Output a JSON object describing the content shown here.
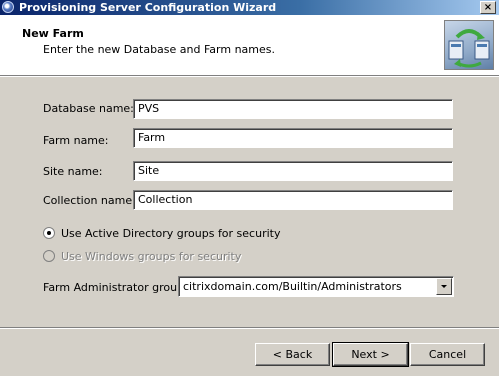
{
  "window": {
    "title": "Provisioning Server Configuration Wizard",
    "close_glyph": "×",
    "icon": "citrix-globe-icon"
  },
  "header": {
    "title": "New Farm",
    "subtitle": "Enter the new Database and Farm names.",
    "logo_icon": "server-sync-icon"
  },
  "form": {
    "database_label": "Database name:",
    "database_value": "PVS",
    "farm_label": "Farm name:",
    "farm_value": "Farm",
    "site_label": "Site name:",
    "site_value": "Site",
    "collection_label": "Collection name:",
    "collection_value": "Collection",
    "radio_ad_label": "Use Active Directory groups for security",
    "radio_ad_selected": true,
    "radio_windows_label": "Use Windows groups for security",
    "radio_windows_selected": false,
    "radio_windows_enabled": false,
    "admin_group_label": "Farm Administrator group:",
    "admin_group_value": "citrixdomain.com/Builtin/Administrators"
  },
  "buttons": {
    "back": "< Back",
    "next": "Next >",
    "cancel": "Cancel"
  }
}
